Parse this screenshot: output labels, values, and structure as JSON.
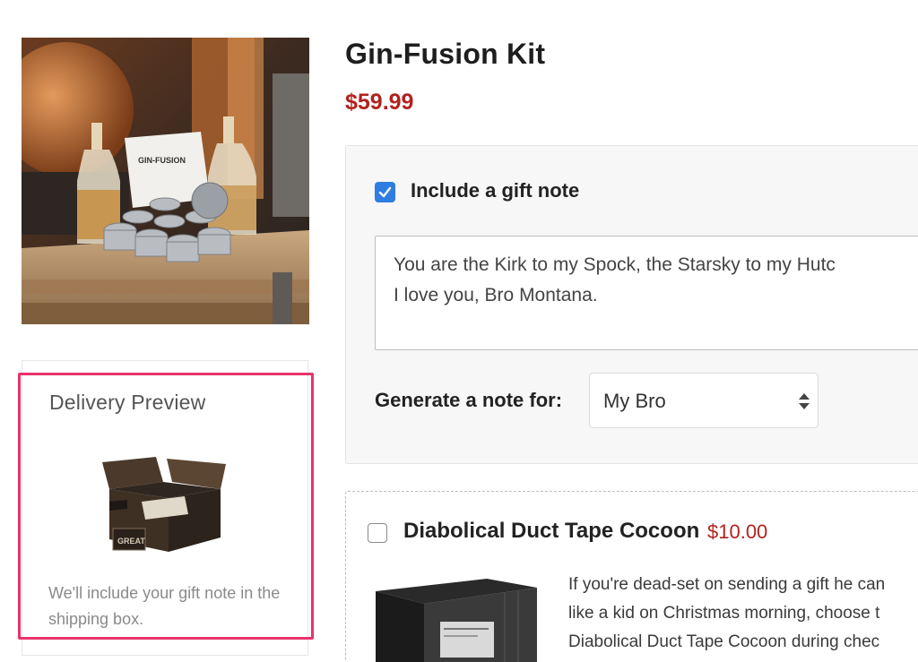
{
  "product": {
    "title": "Gin-Fusion Kit",
    "price": "$59.99",
    "image_label": "GIN-FUSION"
  },
  "delivery_preview": {
    "title": "Delivery Preview",
    "box_label": "GREAT",
    "description": "We'll include your gift note in the shipping box."
  },
  "gift_note": {
    "checked": true,
    "label": "Include a gift note",
    "message_line1": "You are the Kirk to my Spock, the Starsky to my Hutc",
    "message_line2": "I love you, Bro Montana.",
    "generate_label": "Generate a note for:",
    "selected_recipient": "My Bro"
  },
  "addon": {
    "checked": false,
    "title": "Diabolical Duct Tape Cocoon",
    "price": "$10.00",
    "description_lines": [
      "If you're dead-set on sending a gift he can",
      "like a kid on Christmas morning, choose t",
      "Diabolical Duct Tape Cocoon during chec"
    ]
  },
  "colors": {
    "price_red": "#b1231f",
    "highlight_pink": "#e8336b",
    "checkbox_blue": "#2f7de1"
  }
}
